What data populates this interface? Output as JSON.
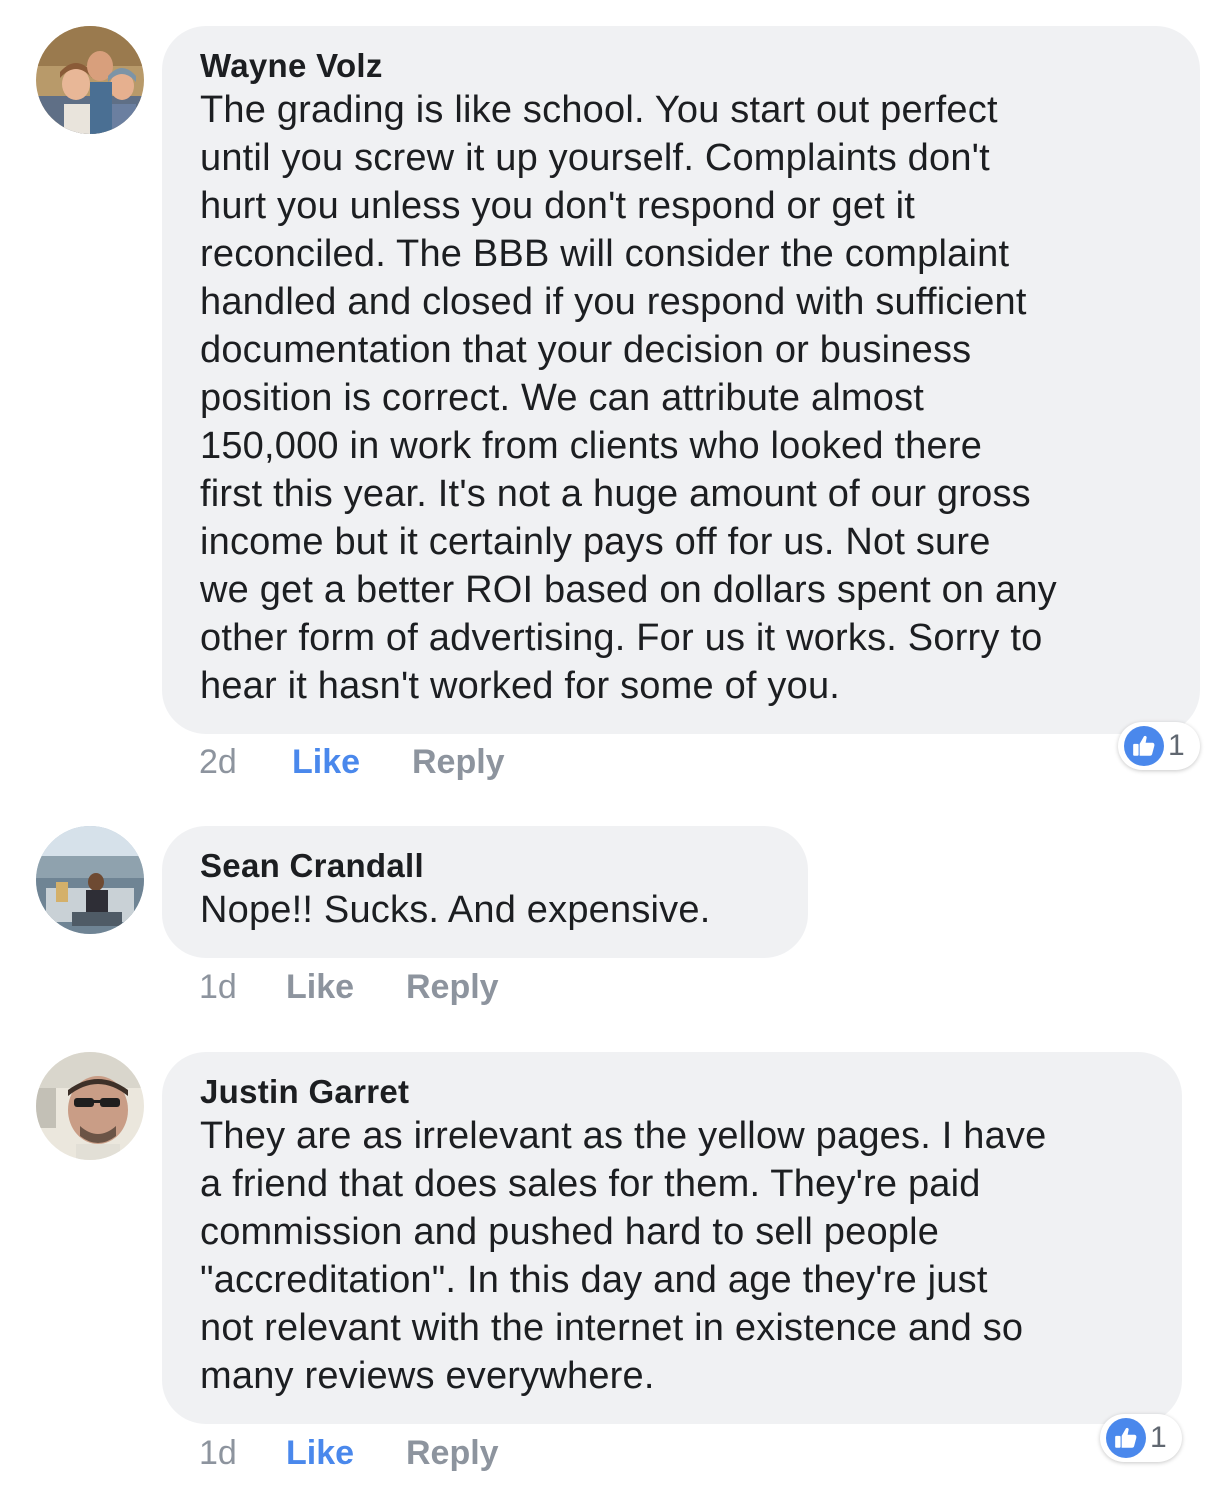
{
  "comments": [
    {
      "author": "Wayne Volz",
      "lines": [
        "The grading is like school. You start out perfect",
        "until you screw it up yourself. Complaints don't",
        "hurt you unless you don't respond or get it",
        "reconciled. The BBB will consider the complaint",
        "handled and closed if you respond with sufficient",
        "documentation that your decision or business",
        "position is correct. We can attribute almost",
        "150,000 in work from clients who looked there",
        "first this year. It's not a huge amount of our gross",
        "income but it certainly pays off for us. Not sure",
        "we get a better ROI based on dollars spent on any",
        "other form of advertising. For us it works. Sorry to",
        "hear it hasn't worked for some of you."
      ],
      "time": "2d",
      "like_label": "Like",
      "reply_label": "Reply",
      "liked": true,
      "reaction_count": "1",
      "reaction_icon": "thumbs-up-icon"
    },
    {
      "author": "Sean Crandall",
      "lines": [
        "Nope!! Sucks. And expensive."
      ],
      "time": "1d",
      "like_label": "Like",
      "reply_label": "Reply",
      "liked": false
    },
    {
      "author": "Justin Garret",
      "lines": [
        "They are as irrelevant as the yellow pages. I have",
        "a friend that does sales for them. They're paid",
        "commission and pushed hard to sell people",
        "\"accreditation\". In this day and age they're just",
        "not relevant with the internet in existence and so",
        "many reviews everywhere."
      ],
      "time": "1d",
      "like_label": "Like",
      "reply_label": "Reply",
      "liked": true,
      "reaction_count": "1",
      "reaction_icon": "thumbs-up-icon"
    }
  ],
  "colors": {
    "bubble": "#f0f1f3",
    "like_active": "#4a88ec",
    "action_gray": "#8d949e",
    "text": "#1c1e21"
  }
}
